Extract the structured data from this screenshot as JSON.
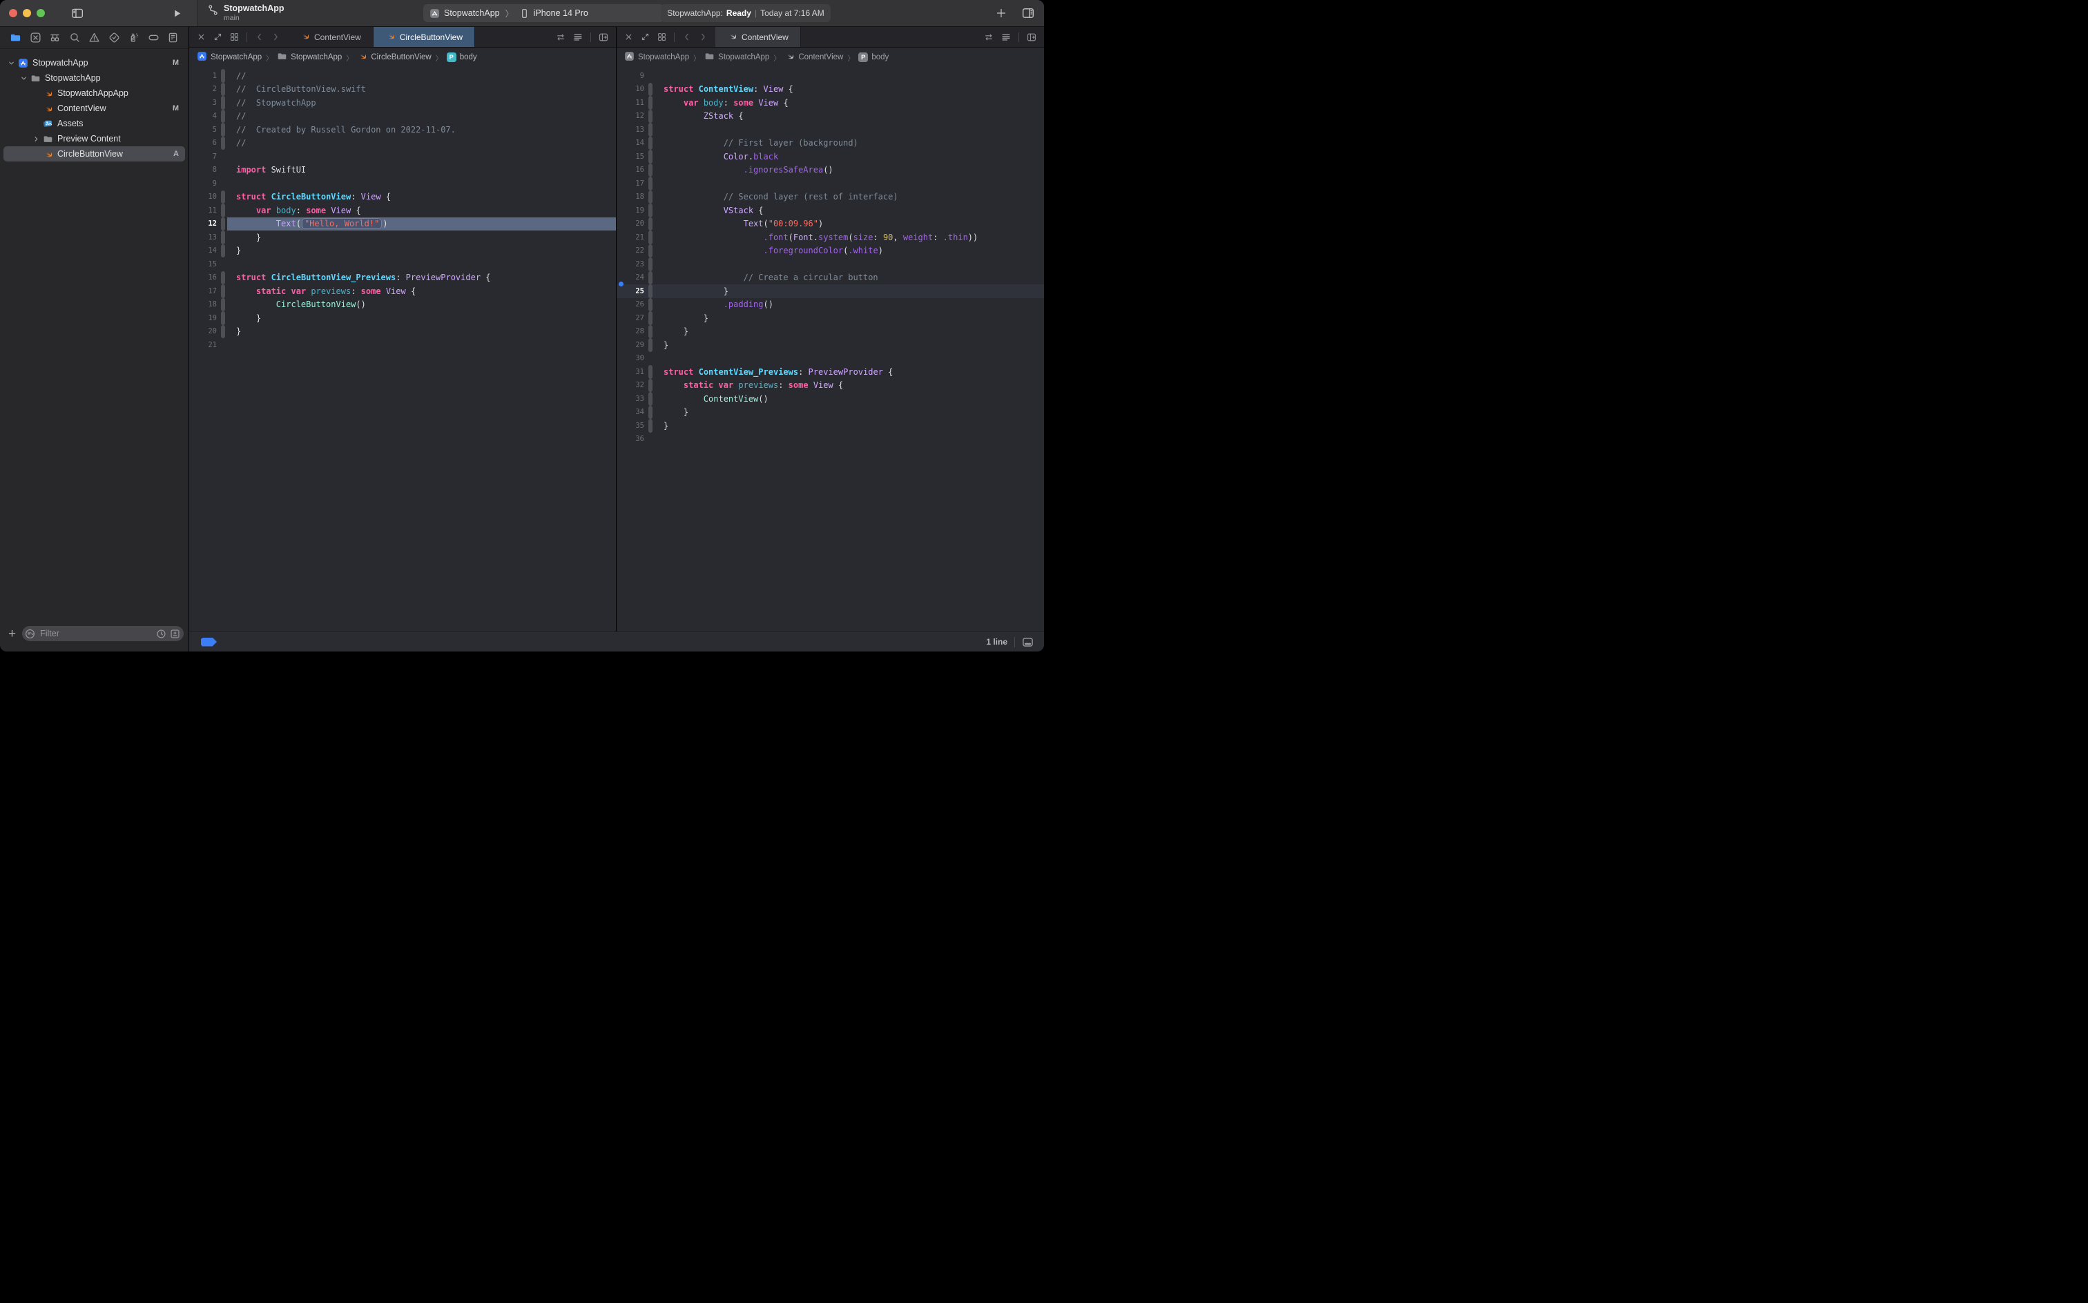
{
  "toolbar": {
    "window_controls": [
      "close",
      "minimize",
      "zoom"
    ],
    "sidebar_toggle_icon": "sidebar-toggle-icon",
    "run_icon": "play-icon",
    "project": {
      "branch_icon": "git-branch-icon",
      "title": "StopwatchApp",
      "subtitle": "main"
    },
    "scheme": {
      "app_icon": "app-project-icon",
      "project": "StopwatchApp",
      "chevron": "〉",
      "device_icon": "iphone-icon",
      "device": "iPhone 14 Pro"
    },
    "status": {
      "project": "StopwatchApp:",
      "state": "Ready",
      "separator": "|",
      "time": "Today at 7:16 AM"
    },
    "add_icon": "plus-icon",
    "editor_layout_icon": "editor-layout-icon"
  },
  "sidebar": {
    "navigator_icons": [
      "project-navigator-icon",
      "source-control-navigator-icon",
      "symbol-navigator-icon",
      "find-navigator-icon",
      "issue-navigator-icon",
      "test-navigator-icon",
      "debug-navigator-icon",
      "breakpoint-navigator-icon",
      "report-navigator-icon"
    ],
    "tree": [
      {
        "label": "StopwatchApp",
        "icon": "app",
        "depth": 0,
        "disclosure": "down",
        "badge": "M"
      },
      {
        "label": "StopwatchApp",
        "icon": "folder",
        "depth": 1,
        "disclosure": "down",
        "badge": ""
      },
      {
        "label": "StopwatchAppApp",
        "icon": "swift",
        "depth": 2,
        "disclosure": "",
        "badge": ""
      },
      {
        "label": "ContentView",
        "icon": "swift",
        "depth": 2,
        "disclosure": "",
        "badge": "M"
      },
      {
        "label": "Assets",
        "icon": "assets",
        "depth": 2,
        "disclosure": "",
        "badge": ""
      },
      {
        "label": "Preview Content",
        "icon": "folder",
        "depth": 2,
        "disclosure": "right",
        "badge": ""
      },
      {
        "label": "CircleButtonView",
        "icon": "swift",
        "depth": 2,
        "disclosure": "",
        "badge": "A",
        "selected": true
      }
    ],
    "add_label": "+",
    "filter": {
      "icon": "filter-menu-icon",
      "placeholder": "Filter",
      "clock_icon": "clock-icon",
      "add_remove_icon": "add-filter-icon"
    }
  },
  "editors": {
    "footer": {
      "line_count": "1 line",
      "debug_icon": "debug-area-icon"
    },
    "left": {
      "unfocused": false,
      "tabs": [
        {
          "label": "ContentView",
          "active": false
        },
        {
          "label": "CircleButtonView",
          "active": true
        }
      ],
      "breadcrumb": [
        {
          "icon": "app",
          "label": "StopwatchApp"
        },
        {
          "icon": "folder",
          "label": "StopwatchApp"
        },
        {
          "icon": "swift",
          "label": "CircleButtonView"
        },
        {
          "icon": "pbadge",
          "label": "body"
        }
      ],
      "lines": [
        {
          "n": 1,
          "bar": true,
          "segs": [
            [
              "//",
              "c"
            ]
          ]
        },
        {
          "n": 2,
          "bar": true,
          "segs": [
            [
              "//  CircleButtonView.swift",
              "c"
            ]
          ]
        },
        {
          "n": 3,
          "bar": true,
          "segs": [
            [
              "//  StopwatchApp",
              "c"
            ]
          ]
        },
        {
          "n": 4,
          "bar": true,
          "segs": [
            [
              "//",
              "c"
            ]
          ]
        },
        {
          "n": 5,
          "bar": true,
          "segs": [
            [
              "//  Created by Russell Gordon on 2022-11-07.",
              "c"
            ]
          ]
        },
        {
          "n": 6,
          "bar": true,
          "segs": [
            [
              "//",
              "c"
            ]
          ]
        },
        {
          "n": 7,
          "segs": []
        },
        {
          "n": 8,
          "segs": [
            [
              "import",
              "k"
            ],
            [
              " SwiftUI",
              ""
            ]
          ]
        },
        {
          "n": 9,
          "segs": []
        },
        {
          "n": 10,
          "bar": true,
          "segs": [
            [
              "struct",
              "k"
            ],
            [
              " ",
              ""
            ],
            [
              "CircleButtonView",
              "td"
            ],
            [
              ": ",
              ""
            ],
            [
              "View",
              "st"
            ],
            [
              " {",
              ""
            ]
          ]
        },
        {
          "n": 11,
          "bar": true,
          "segs": [
            [
              "    ",
              ""
            ],
            [
              "var",
              "k"
            ],
            [
              " ",
              ""
            ],
            [
              "body",
              "md"
            ],
            [
              ": ",
              ""
            ],
            [
              "some",
              "k"
            ],
            [
              " ",
              ""
            ],
            [
              "View",
              "st"
            ],
            [
              " {",
              ""
            ]
          ]
        },
        {
          "n": 12,
          "bar": true,
          "sel": true,
          "segs": [
            [
              "        ",
              ""
            ],
            [
              "Text",
              "st"
            ],
            [
              "(",
              ""
            ],
            [
              "\"Hello, World!\"",
              "sb"
            ],
            [
              ")",
              ""
            ]
          ]
        },
        {
          "n": 13,
          "bar": true,
          "segs": [
            [
              "    }",
              ""
            ]
          ]
        },
        {
          "n": 14,
          "bar": true,
          "segs": [
            [
              "}",
              ""
            ]
          ]
        },
        {
          "n": 15,
          "segs": []
        },
        {
          "n": 16,
          "bar": true,
          "segs": [
            [
              "struct",
              "k"
            ],
            [
              " ",
              ""
            ],
            [
              "CircleButtonView_Previews",
              "td"
            ],
            [
              ": ",
              ""
            ],
            [
              "PreviewProvider",
              "st"
            ],
            [
              " {",
              ""
            ]
          ]
        },
        {
          "n": 17,
          "bar": true,
          "segs": [
            [
              "    ",
              ""
            ],
            [
              "static",
              "k"
            ],
            [
              " ",
              ""
            ],
            [
              "var",
              "k"
            ],
            [
              " ",
              ""
            ],
            [
              "previews",
              "md"
            ],
            [
              ": ",
              ""
            ],
            [
              "some",
              "k"
            ],
            [
              " ",
              ""
            ],
            [
              "View",
              "st"
            ],
            [
              " {",
              ""
            ]
          ]
        },
        {
          "n": 18,
          "bar": true,
          "segs": [
            [
              "        ",
              ""
            ],
            [
              "CircleButtonView",
              "pt"
            ],
            [
              "()",
              ""
            ]
          ]
        },
        {
          "n": 19,
          "bar": true,
          "segs": [
            [
              "    }",
              ""
            ]
          ]
        },
        {
          "n": 20,
          "bar": true,
          "segs": [
            [
              "}",
              ""
            ]
          ]
        },
        {
          "n": 21,
          "segs": []
        }
      ]
    },
    "right": {
      "unfocused": true,
      "tabs": [
        {
          "label": "ContentView",
          "active": true
        }
      ],
      "breadcrumb": [
        {
          "icon": "app",
          "label": "StopwatchApp"
        },
        {
          "icon": "folder",
          "label": "StopwatchApp"
        },
        {
          "icon": "swift",
          "label": "ContentView"
        },
        {
          "icon": "pbadge",
          "label": "body"
        }
      ],
      "lines": [
        {
          "n": 9,
          "segs": []
        },
        {
          "n": 10,
          "bar": true,
          "segs": [
            [
              "struct",
              "k"
            ],
            [
              " ",
              ""
            ],
            [
              "ContentView",
              "td"
            ],
            [
              ": ",
              ""
            ],
            [
              "View",
              "st"
            ],
            [
              " {",
              ""
            ]
          ]
        },
        {
          "n": 11,
          "bar": true,
          "segs": [
            [
              "    ",
              ""
            ],
            [
              "var",
              "k"
            ],
            [
              " ",
              ""
            ],
            [
              "body",
              "md"
            ],
            [
              ": ",
              ""
            ],
            [
              "some",
              "k"
            ],
            [
              " ",
              ""
            ],
            [
              "View",
              "st"
            ],
            [
              " {",
              ""
            ]
          ]
        },
        {
          "n": 12,
          "bar": true,
          "segs": [
            [
              "        ",
              ""
            ],
            [
              "ZStack",
              "st"
            ],
            [
              " {",
              ""
            ]
          ]
        },
        {
          "n": 13,
          "bar": true,
          "segs": []
        },
        {
          "n": 14,
          "bar": true,
          "segs": [
            [
              "            ",
              ""
            ],
            [
              "// First layer (background)",
              "c"
            ]
          ]
        },
        {
          "n": 15,
          "bar": true,
          "segs": [
            [
              "            ",
              ""
            ],
            [
              "Color",
              "st"
            ],
            [
              ".",
              ""
            ],
            [
              "black",
              "sm"
            ]
          ]
        },
        {
          "n": 16,
          "bar": true,
          "segs": [
            [
              "                ",
              ""
            ],
            [
              ".ignoresSafeArea",
              "sm"
            ],
            [
              "()",
              ""
            ]
          ]
        },
        {
          "n": 17,
          "bar": true,
          "segs": []
        },
        {
          "n": 18,
          "bar": true,
          "segs": [
            [
              "            ",
              ""
            ],
            [
              "// Second layer (rest of interface)",
              "c"
            ]
          ]
        },
        {
          "n": 19,
          "bar": true,
          "segs": [
            [
              "            ",
              ""
            ],
            [
              "VStack",
              "st"
            ],
            [
              " {",
              ""
            ]
          ]
        },
        {
          "n": 20,
          "bar": true,
          "segs": [
            [
              "                ",
              ""
            ],
            [
              "Text",
              "st"
            ],
            [
              "(",
              ""
            ],
            [
              "\"00:09.96\"",
              "s"
            ],
            [
              ")",
              ""
            ]
          ]
        },
        {
          "n": 21,
          "bar": true,
          "segs": [
            [
              "                    ",
              ""
            ],
            [
              ".font",
              "sm"
            ],
            [
              "(",
              ""
            ],
            [
              "Font",
              "st"
            ],
            [
              ".",
              ""
            ],
            [
              "system",
              "sm"
            ],
            [
              "(",
              ""
            ],
            [
              "size",
              "sm"
            ],
            [
              ": ",
              ""
            ],
            [
              "90",
              "n"
            ],
            [
              ", ",
              ""
            ],
            [
              "weight",
              "sm"
            ],
            [
              ": ",
              ""
            ],
            [
              ".thin",
              "sm"
            ],
            [
              "))",
              ""
            ]
          ]
        },
        {
          "n": 22,
          "bar": true,
          "segs": [
            [
              "                    ",
              ""
            ],
            [
              ".foregroundColor",
              "sm"
            ],
            [
              "(",
              ""
            ],
            [
              ".white",
              "sm"
            ],
            [
              ")",
              ""
            ]
          ]
        },
        {
          "n": 23,
          "bar": true,
          "segs": []
        },
        {
          "n": 24,
          "bar": true,
          "segs": [
            [
              "                ",
              ""
            ],
            [
              "// Create a circular button",
              "c"
            ]
          ]
        },
        {
          "n": 25,
          "bar": true,
          "cur": true,
          "dot": true,
          "segs": [
            [
              "            }",
              ""
            ]
          ]
        },
        {
          "n": 26,
          "bar": true,
          "segs": [
            [
              "            ",
              ""
            ],
            [
              ".padding",
              "sm"
            ],
            [
              "()",
              ""
            ]
          ]
        },
        {
          "n": 27,
          "bar": true,
          "segs": [
            [
              "        }",
              ""
            ]
          ]
        },
        {
          "n": 28,
          "bar": true,
          "segs": [
            [
              "    }",
              ""
            ]
          ]
        },
        {
          "n": 29,
          "bar": true,
          "segs": [
            [
              "}",
              ""
            ]
          ]
        },
        {
          "n": 30,
          "segs": []
        },
        {
          "n": 31,
          "bar": true,
          "segs": [
            [
              "struct",
              "k"
            ],
            [
              " ",
              ""
            ],
            [
              "ContentView_Previews",
              "td"
            ],
            [
              ": ",
              ""
            ],
            [
              "PreviewProvider",
              "st"
            ],
            [
              " {",
              ""
            ]
          ]
        },
        {
          "n": 32,
          "bar": true,
          "segs": [
            [
              "    ",
              ""
            ],
            [
              "static",
              "k"
            ],
            [
              " ",
              ""
            ],
            [
              "var",
              "k"
            ],
            [
              " ",
              ""
            ],
            [
              "previews",
              "md"
            ],
            [
              ": ",
              ""
            ],
            [
              "some",
              "k"
            ],
            [
              " ",
              ""
            ],
            [
              "View",
              "st"
            ],
            [
              " {",
              ""
            ]
          ]
        },
        {
          "n": 33,
          "bar": true,
          "segs": [
            [
              "        ",
              ""
            ],
            [
              "ContentView",
              "pt"
            ],
            [
              "()",
              ""
            ]
          ]
        },
        {
          "n": 34,
          "bar": true,
          "segs": [
            [
              "    }",
              ""
            ]
          ]
        },
        {
          "n": 35,
          "bar": true,
          "segs": [
            [
              "}",
              ""
            ]
          ]
        },
        {
          "n": 36,
          "segs": []
        }
      ]
    }
  },
  "colors": {
    "accent_blue": "#3D7DF5",
    "active_tab_blue": "#3E5878",
    "selected_line_blue_gray": "#5A6882",
    "swift_orange": "#F7862E",
    "keyword_pink": "#FC5FA3",
    "comment_gray": "#7F8C98",
    "string_coral": "#FC6A5D",
    "number_yellow": "#D0BF69",
    "type_decl_cyan": "#5DD8FF",
    "member_decl_teal": "#4FB2C9",
    "sdk_type_lavender": "#D0A8FF",
    "sdk_member_purple": "#A167E6",
    "project_type_mint": "#9EF1DD",
    "traffic_red": "#EC6A5E",
    "traffic_yellow": "#F5BF4F",
    "traffic_green": "#61C454",
    "assets_blue": "#4AA3E8",
    "pbadge_teal": "#43B9C7",
    "nav_folder_blue": "#4D9BF8"
  }
}
